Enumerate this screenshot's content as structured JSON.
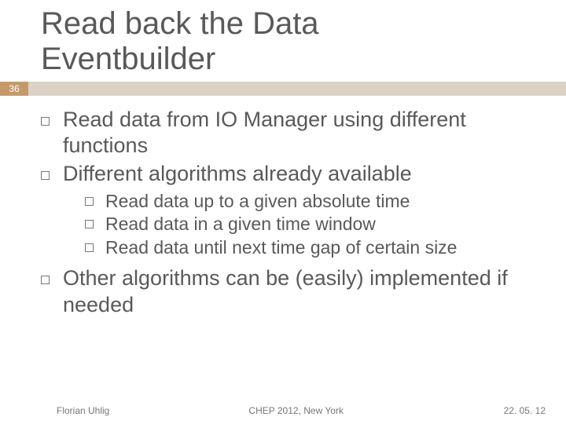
{
  "title_line1": "Read back the Data",
  "title_line2": "Eventbuilder",
  "page_number": "36",
  "bullets": {
    "b1": "Read data from IO Manager using different functions",
    "b2": "Different algorithms already available",
    "sub": {
      "s1": {
        "prefix": "Read",
        "rest": " data up to a given absolute time"
      },
      "s2": {
        "prefix": "Read",
        "rest": " data in a given time window"
      },
      "s3": {
        "prefix": "Read",
        "rest": " data until next time gap of certain size"
      }
    },
    "b3": "Other algorithms can be (easily) implemented if needed"
  },
  "footer": {
    "author": "Florian Uhlig",
    "event": "CHEP 2012, New York",
    "date": "22. 05. 12"
  }
}
